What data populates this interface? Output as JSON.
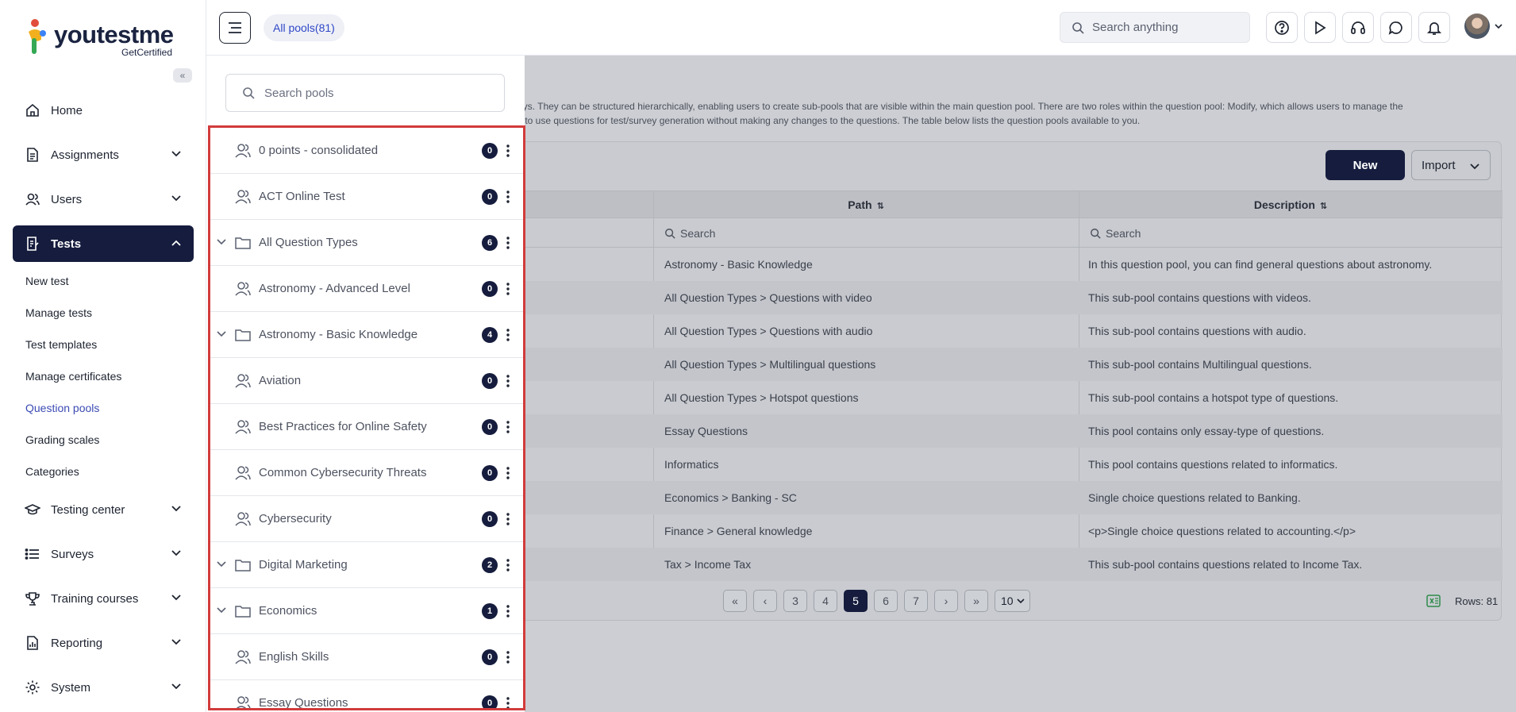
{
  "app": {
    "logo_text": "youtestme",
    "logo_subtitle": "GetCertified"
  },
  "sidebar": {
    "collapse_icon": "double-chevron-left-icon",
    "items": [
      {
        "label": "Home",
        "icon": "home-icon"
      },
      {
        "label": "Assignments",
        "icon": "document-icon"
      },
      {
        "label": "Users",
        "icon": "users-icon"
      },
      {
        "label": "Tests",
        "icon": "tests-icon",
        "active": true
      },
      {
        "label": "Testing center",
        "icon": "graduation-cap-icon"
      },
      {
        "label": "Surveys",
        "icon": "list-icon"
      },
      {
        "label": "Training courses",
        "icon": "trophy-icon"
      },
      {
        "label": "Reporting",
        "icon": "report-icon"
      },
      {
        "label": "System",
        "icon": "gear-icon"
      }
    ],
    "sub_items": [
      {
        "label": "New test"
      },
      {
        "label": "Manage tests"
      },
      {
        "label": "Test templates"
      },
      {
        "label": "Manage certificates"
      },
      {
        "label": "Question pools",
        "current": true
      },
      {
        "label": "Grading scales"
      },
      {
        "label": "Categories"
      }
    ]
  },
  "topbar": {
    "pools_pill": "All pools(81)",
    "search_placeholder": "Search anything",
    "icons": [
      "help-icon",
      "play-icon",
      "headset-icon",
      "chat-icon",
      "bell-icon"
    ]
  },
  "pools_panel": {
    "search_placeholder": "Search pools",
    "items": [
      {
        "label": "0 points - consolidated",
        "count": "0",
        "type": "users-icon",
        "expandable": false
      },
      {
        "label": "ACT Online Test",
        "count": "0",
        "type": "users-icon",
        "expandable": false
      },
      {
        "label": "All Question Types",
        "count": "6",
        "type": "folder-icon",
        "expandable": true
      },
      {
        "label": "Astronomy - Advanced Level",
        "count": "0",
        "type": "users-icon",
        "expandable": false
      },
      {
        "label": "Astronomy - Basic Knowledge",
        "count": "4",
        "type": "folder-icon",
        "expandable": true
      },
      {
        "label": "Aviation",
        "count": "0",
        "type": "users-icon",
        "expandable": false
      },
      {
        "label": "Best Practices for Online Safety",
        "count": "0",
        "type": "users-icon",
        "expandable": false
      },
      {
        "label": "Common Cybersecurity Threats",
        "count": "0",
        "type": "users-icon",
        "expandable": false
      },
      {
        "label": "Cybersecurity",
        "count": "0",
        "type": "users-icon",
        "expandable": false
      },
      {
        "label": "Digital Marketing",
        "count": "2",
        "type": "folder-icon",
        "expandable": true
      },
      {
        "label": "Economics",
        "count": "1",
        "type": "folder-icon",
        "expandable": true
      },
      {
        "label": "English Skills",
        "count": "0",
        "type": "users-icon",
        "expandable": false
      },
      {
        "label": "Essay Questions",
        "count": "0",
        "type": "users-icon",
        "expandable": false
      }
    ]
  },
  "main": {
    "description_line1": "eys. They can be structured hierarchically, enabling users to create sub-pools that are visible within the main question pool. There are two roles within the question pool: Modify, which allows users to manage the",
    "description_line2": "s to use questions for test/survey generation without making any changes to the questions. The table below lists the question pools available to you.",
    "new_button": "New",
    "import_button": "Import",
    "columns": [
      {
        "label": "Path"
      },
      {
        "label": "Description"
      }
    ],
    "filter_placeholder": "Search",
    "rows": [
      {
        "path": "Astronomy - Basic Knowledge",
        "description": "In this question pool, you can find general questions about astronomy."
      },
      {
        "path": "All Question Types > Questions with video",
        "description": "This sub-pool contains questions with videos."
      },
      {
        "path": "All Question Types > Questions with audio",
        "description": "This sub-pool contains questions with audio."
      },
      {
        "path": "All Question Types > Multilingual questions",
        "description": "This sub-pool contains Multilingual questions."
      },
      {
        "path": "All Question Types > Hotspot questions",
        "description": "This sub-pool contains a hotspot type of questions."
      },
      {
        "path": "Essay Questions",
        "description": "This pool contains only essay-type of questions."
      },
      {
        "path": "Informatics",
        "description": "This pool contains questions related to informatics."
      },
      {
        "path": "Economics > Banking - SC",
        "description": "Single choice questions related to Banking."
      },
      {
        "path": "Finance > General knowledge",
        "description": "<p>Single choice questions related to accounting.</p>"
      },
      {
        "path": "Tax > Income Tax",
        "description": "This sub-pool contains questions related to Income Tax."
      }
    ],
    "pagination": {
      "pages": [
        "3",
        "4",
        "5",
        "6",
        "7"
      ],
      "current": "5",
      "page_size": "10",
      "rows_label": "Rows: 81"
    }
  },
  "colors": {
    "primary": "#151c3d",
    "accent_link": "#2f47c7",
    "highlight_border": "#d23b3b"
  }
}
